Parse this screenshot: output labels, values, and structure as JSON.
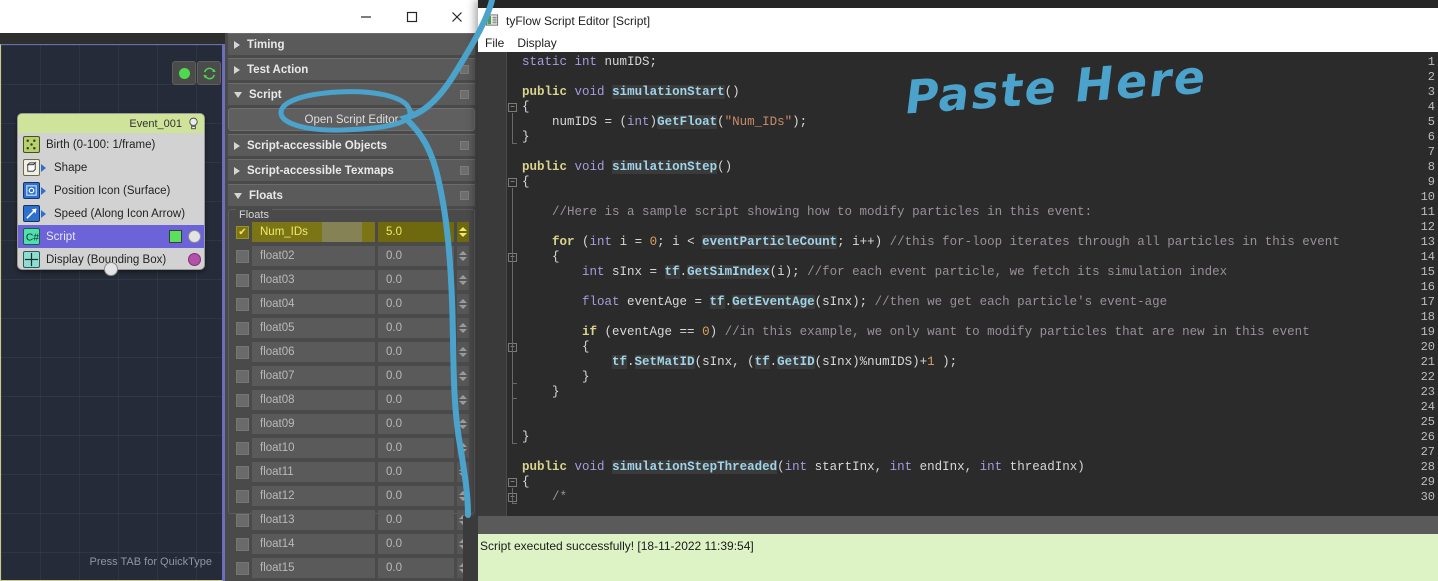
{
  "max_window": {
    "controls": {
      "minimize": "minimize-icon",
      "maximize": "maximize-icon",
      "close": "close-icon"
    },
    "viewport": {
      "hint": "Press TAB for QuickType",
      "toolbar_buttons": [
        "status-dot-icon",
        "refresh-icon"
      ],
      "event_node": {
        "title": "Event_001",
        "bulb_icon": "lightbulb-icon",
        "operators": [
          {
            "label": "Birth (0-100: 1/frame)",
            "icon": "birth-icon",
            "selected": false,
            "arrow": false,
            "knob": null,
            "chip": false
          },
          {
            "label": "Shape",
            "icon": "shape-icon",
            "selected": false,
            "arrow": true,
            "knob": null,
            "chip": false
          },
          {
            "label": "Position Icon (Surface)",
            "icon": "position-icon",
            "selected": false,
            "arrow": true,
            "knob": null,
            "chip": false
          },
          {
            "label": "Speed (Along Icon Arrow)",
            "icon": "speed-icon",
            "selected": false,
            "arrow": true,
            "knob": null,
            "chip": false
          },
          {
            "label": "Script",
            "icon": "csharp-script-icon",
            "selected": true,
            "arrow": false,
            "knob": "grey",
            "chip": true
          },
          {
            "label": "Display (Bounding Box)",
            "icon": "display-icon",
            "selected": false,
            "arrow": false,
            "knob": "purple",
            "chip": false
          }
        ]
      }
    }
  },
  "command_panel": {
    "rollouts": [
      {
        "label": "Timing",
        "open": false,
        "pin": false
      },
      {
        "label": "Test Action",
        "open": false,
        "pin": true
      },
      {
        "label": "Script",
        "open": true,
        "pin": true
      },
      {
        "label": "Script-accessible Objects",
        "open": false,
        "pin": true
      },
      {
        "label": "Script-accessible Texmaps",
        "open": false,
        "pin": true
      },
      {
        "label": "Floats",
        "open": true,
        "pin": true
      }
    ],
    "open_script_editor_label": "Open Script Editor",
    "floats_group_legend": "Floats",
    "floats": [
      {
        "name": "Num_IDs",
        "value": "5.0",
        "checked": true,
        "highlighted": true
      },
      {
        "name": "float02",
        "value": "0.0",
        "checked": false,
        "highlighted": false
      },
      {
        "name": "float03",
        "value": "0.0",
        "checked": false,
        "highlighted": false
      },
      {
        "name": "float04",
        "value": "0.0",
        "checked": false,
        "highlighted": false
      },
      {
        "name": "float05",
        "value": "0.0",
        "checked": false,
        "highlighted": false
      },
      {
        "name": "float06",
        "value": "0.0",
        "checked": false,
        "highlighted": false
      },
      {
        "name": "float07",
        "value": "0.0",
        "checked": false,
        "highlighted": false
      },
      {
        "name": "float08",
        "value": "0.0",
        "checked": false,
        "highlighted": false
      },
      {
        "name": "float09",
        "value": "0.0",
        "checked": false,
        "highlighted": false
      },
      {
        "name": "float10",
        "value": "0.0",
        "checked": false,
        "highlighted": false
      },
      {
        "name": "float11",
        "value": "0.0",
        "checked": false,
        "highlighted": false
      },
      {
        "name": "float12",
        "value": "0.0",
        "checked": false,
        "highlighted": false
      },
      {
        "name": "float13",
        "value": "0.0",
        "checked": false,
        "highlighted": false
      },
      {
        "name": "float14",
        "value": "0.0",
        "checked": false,
        "highlighted": false
      },
      {
        "name": "float15",
        "value": "0.0",
        "checked": false,
        "highlighted": false
      }
    ]
  },
  "script_editor": {
    "title": "tyFlow Script Editor [Script]",
    "title_icon": "script-editor-icon",
    "menus": [
      "File",
      "Display"
    ],
    "status_text": "Script executed successfully! [18-11-2022 11:39:54]",
    "line_numbers": [
      1,
      2,
      3,
      4,
      5,
      6,
      7,
      8,
      9,
      10,
      11,
      12,
      13,
      14,
      15,
      16,
      17,
      18,
      19,
      20,
      21,
      22,
      23,
      24,
      25,
      26,
      27,
      28,
      29,
      30
    ],
    "lines": [
      {
        "n": 1,
        "tokens": [
          {
            "t": "static",
            "c": "kw"
          },
          {
            "t": " ",
            "c": "plain"
          },
          {
            "t": "int",
            "c": "kw"
          },
          {
            "t": " numIDS;",
            "c": "plain"
          }
        ]
      },
      {
        "n": 2,
        "tokens": []
      },
      {
        "n": 3,
        "tokens": [
          {
            "t": "public",
            "c": "kw2"
          },
          {
            "t": " ",
            "c": "plain"
          },
          {
            "t": "void",
            "c": "kw"
          },
          {
            "t": " ",
            "c": "plain"
          },
          {
            "t": "simulationStart",
            "c": "fn"
          },
          {
            "t": "()",
            "c": "plain"
          }
        ]
      },
      {
        "n": 4,
        "tokens": [
          {
            "t": "{",
            "c": "plain"
          }
        ]
      },
      {
        "n": 5,
        "tokens": [
          {
            "t": "    numIDS = (",
            "c": "plain"
          },
          {
            "t": "int",
            "c": "kw"
          },
          {
            "t": ")",
            "c": "plain"
          },
          {
            "t": "GetFloat",
            "c": "fn"
          },
          {
            "t": "(",
            "c": "plain"
          },
          {
            "t": "\"Num_IDs\"",
            "c": "str"
          },
          {
            "t": ");",
            "c": "plain"
          }
        ]
      },
      {
        "n": 6,
        "tokens": [
          {
            "t": "}",
            "c": "plain"
          }
        ]
      },
      {
        "n": 7,
        "tokens": []
      },
      {
        "n": 8,
        "tokens": [
          {
            "t": "public",
            "c": "kw2"
          },
          {
            "t": " ",
            "c": "plain"
          },
          {
            "t": "void",
            "c": "kw"
          },
          {
            "t": " ",
            "c": "plain"
          },
          {
            "t": "simulationStep",
            "c": "fn"
          },
          {
            "t": "()",
            "c": "plain"
          }
        ]
      },
      {
        "n": 9,
        "tokens": [
          {
            "t": "{",
            "c": "plain"
          }
        ]
      },
      {
        "n": 10,
        "tokens": []
      },
      {
        "n": 11,
        "tokens": [
          {
            "t": "    //Here is a sample script showing how to modify particles in this event:",
            "c": "cmt"
          }
        ]
      },
      {
        "n": 12,
        "tokens": []
      },
      {
        "n": 13,
        "tokens": [
          {
            "t": "    ",
            "c": "plain"
          },
          {
            "t": "for",
            "c": "kw2"
          },
          {
            "t": " (",
            "c": "plain"
          },
          {
            "t": "int",
            "c": "kw"
          },
          {
            "t": " i = ",
            "c": "plain"
          },
          {
            "t": "0",
            "c": "num"
          },
          {
            "t": "; i < ",
            "c": "plain"
          },
          {
            "t": "eventParticleCount",
            "c": "fn"
          },
          {
            "t": "; i++) ",
            "c": "plain"
          },
          {
            "t": "//this for-loop iterates through all particles in this event",
            "c": "cmt"
          }
        ]
      },
      {
        "n": 14,
        "tokens": [
          {
            "t": "    {",
            "c": "plain"
          }
        ]
      },
      {
        "n": 15,
        "tokens": [
          {
            "t": "        ",
            "c": "plain"
          },
          {
            "t": "int",
            "c": "kw"
          },
          {
            "t": " sInx = ",
            "c": "plain"
          },
          {
            "t": "tf",
            "c": "fn"
          },
          {
            "t": ".",
            "c": "plain"
          },
          {
            "t": "GetSimIndex",
            "c": "fn"
          },
          {
            "t": "(i); ",
            "c": "plain"
          },
          {
            "t": "//for each event particle, we fetch its simulation index",
            "c": "cmt"
          }
        ]
      },
      {
        "n": 16,
        "tokens": []
      },
      {
        "n": 17,
        "tokens": [
          {
            "t": "        ",
            "c": "plain"
          },
          {
            "t": "float",
            "c": "kw"
          },
          {
            "t": " eventAge = ",
            "c": "plain"
          },
          {
            "t": "tf",
            "c": "fn"
          },
          {
            "t": ".",
            "c": "plain"
          },
          {
            "t": "GetEventAge",
            "c": "fn"
          },
          {
            "t": "(sInx); ",
            "c": "plain"
          },
          {
            "t": "//then we get each particle's event-age",
            "c": "cmt"
          }
        ]
      },
      {
        "n": 18,
        "tokens": []
      },
      {
        "n": 19,
        "tokens": [
          {
            "t": "        ",
            "c": "plain"
          },
          {
            "t": "if",
            "c": "kw2"
          },
          {
            "t": " (eventAge == ",
            "c": "plain"
          },
          {
            "t": "0",
            "c": "num"
          },
          {
            "t": ") ",
            "c": "plain"
          },
          {
            "t": "//in this example, we only want to modify particles that are new in this event",
            "c": "cmt"
          }
        ]
      },
      {
        "n": 20,
        "tokens": [
          {
            "t": "        {",
            "c": "plain"
          }
        ]
      },
      {
        "n": 21,
        "tokens": [
          {
            "t": "            ",
            "c": "plain"
          },
          {
            "t": "tf",
            "c": "fn"
          },
          {
            "t": ".",
            "c": "plain"
          },
          {
            "t": "SetMatID",
            "c": "fn"
          },
          {
            "t": "(sInx, (",
            "c": "plain"
          },
          {
            "t": "tf",
            "c": "fn"
          },
          {
            "t": ".",
            "c": "plain"
          },
          {
            "t": "GetID",
            "c": "fn"
          },
          {
            "t": "(sInx)%numIDS)+",
            "c": "plain"
          },
          {
            "t": "1",
            "c": "num"
          },
          {
            "t": " );",
            "c": "plain"
          }
        ]
      },
      {
        "n": 22,
        "tokens": [
          {
            "t": "        }",
            "c": "plain"
          }
        ]
      },
      {
        "n": 23,
        "tokens": [
          {
            "t": "    }",
            "c": "plain"
          }
        ]
      },
      {
        "n": 24,
        "tokens": []
      },
      {
        "n": 25,
        "tokens": []
      },
      {
        "n": 26,
        "tokens": [
          {
            "t": "}",
            "c": "plain"
          }
        ]
      },
      {
        "n": 27,
        "tokens": []
      },
      {
        "n": 28,
        "tokens": [
          {
            "t": "public",
            "c": "kw2"
          },
          {
            "t": " ",
            "c": "plain"
          },
          {
            "t": "void",
            "c": "kw"
          },
          {
            "t": " ",
            "c": "plain"
          },
          {
            "t": "simulationStepThreaded",
            "c": "fn"
          },
          {
            "t": "(",
            "c": "plain"
          },
          {
            "t": "int",
            "c": "kw"
          },
          {
            "t": " startInx, ",
            "c": "plain"
          },
          {
            "t": "int",
            "c": "kw"
          },
          {
            "t": " endInx, ",
            "c": "plain"
          },
          {
            "t": "int",
            "c": "kw"
          },
          {
            "t": " threadInx)",
            "c": "plain"
          }
        ]
      },
      {
        "n": 29,
        "tokens": [
          {
            "t": "{",
            "c": "plain"
          }
        ]
      },
      {
        "n": 30,
        "tokens": [
          {
            "t": "    /*",
            "c": "cmt"
          }
        ]
      }
    ]
  },
  "annotations": {
    "paste_here": "Paste  Here",
    "ink_color": "#4ba3cc",
    "circle_target": "Open Script Editor button"
  }
}
